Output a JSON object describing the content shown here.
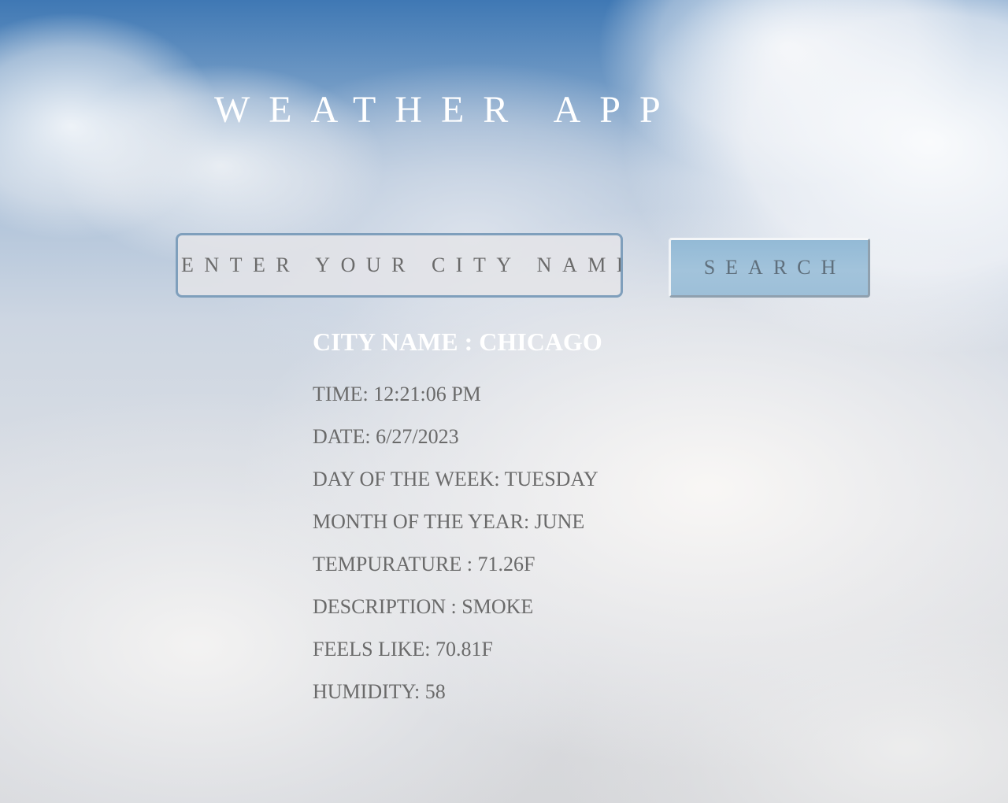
{
  "app": {
    "title": "WEATHER APP"
  },
  "search": {
    "placeholder": "ENTER YOUR CITY NAME",
    "value": "",
    "button_label": "SEARCH"
  },
  "result": {
    "city_line": "CITY NAME : CHICAGO",
    "time": "TIME: 12:21:06 PM",
    "date": "DATE: 6/27/2023",
    "day_of_week": "DAY OF THE WEEK: TUESDAY",
    "month_of_year": "MONTH OF THE YEAR: JUNE",
    "temperature": "TEMPURATURE : 71.26F",
    "description": "DESCRIPTION : SMOKE",
    "feels_like": "FEELS LIKE: 70.81F",
    "humidity": "HUMIDITY: 58"
  },
  "colors": {
    "sky_blue": "#3f78b4",
    "title_text": "#ffffff",
    "info_text": "#6a6a6a",
    "input_border": "#7f9fbc",
    "button_fill": "#9dbfd8"
  }
}
